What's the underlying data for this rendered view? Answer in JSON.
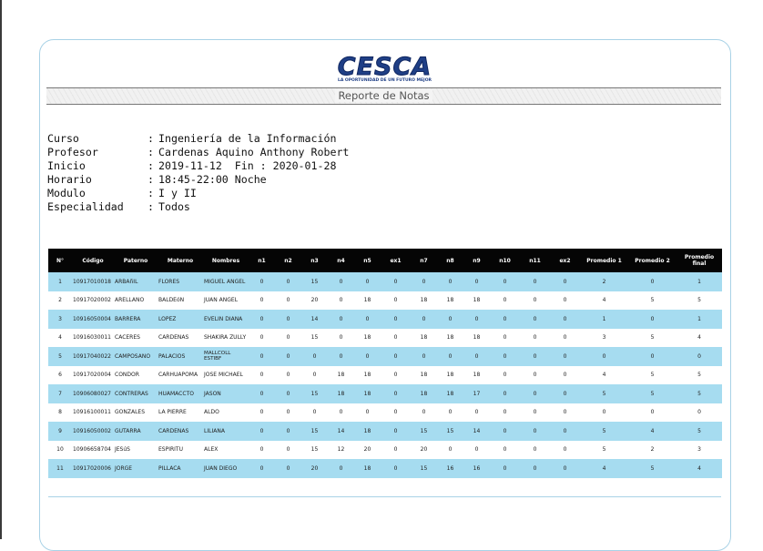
{
  "header": {
    "logo_text": "CESCA",
    "logo_tagline": "LA OPORTUNIDAD DE UN FUTURO MEJOR",
    "report_title": "Reporte de Notas"
  },
  "info": {
    "curso_label": "Curso",
    "curso_value": "Ingeniería de la Información",
    "profesor_label": "Profesor",
    "profesor_value": "Cardenas Aquino Anthony Robert",
    "inicio_label": "Inicio",
    "inicio_value": "2019-11-12  Fin : 2020-01-28",
    "horario_label": "Horario",
    "horario_value": "18:45-22:00 Noche",
    "modulo_label": "Modulo",
    "modulo_value": "I y II",
    "especialidad_label": "Especialidad",
    "especialidad_value": "Todos",
    "separator": ":"
  },
  "table": {
    "headers": [
      "N°",
      "Código",
      "Paterno",
      "Materno",
      "Nombres",
      "n1",
      "n2",
      "n3",
      "n4",
      "n5",
      "ex1",
      "n7",
      "n8",
      "n9",
      "n10",
      "n11",
      "ex2",
      "Promedio 1",
      "Promedio 2",
      "Promedio final"
    ],
    "rows": [
      [
        "1",
        "10917010018",
        "ARBAñIL",
        "FLORES",
        "MIGUEL ANGEL",
        "0",
        "0",
        "15",
        "0",
        "0",
        "0",
        "0",
        "0",
        "0",
        "0",
        "0",
        "0",
        "2",
        "0",
        "1"
      ],
      [
        "2",
        "10917020002",
        "ARELLANO",
        "BALDEóN",
        "JUAN ANGEL",
        "0",
        "0",
        "20",
        "0",
        "18",
        "0",
        "18",
        "18",
        "18",
        "0",
        "0",
        "0",
        "4",
        "5",
        "5"
      ],
      [
        "3",
        "10916050004",
        "BARRERA",
        "LOPEZ",
        "EVELIN DIANA",
        "0",
        "0",
        "14",
        "0",
        "0",
        "0",
        "0",
        "0",
        "0",
        "0",
        "0",
        "0",
        "1",
        "0",
        "1"
      ],
      [
        "4",
        "10916030011",
        "CACERES",
        "CARDENAS",
        "SHAKIRA ZULLY",
        "0",
        "0",
        "15",
        "0",
        "18",
        "0",
        "18",
        "18",
        "18",
        "0",
        "0",
        "0",
        "3",
        "5",
        "4"
      ],
      [
        "5",
        "10917040022",
        "CAMPOSANO",
        "PALACIOS",
        "MALLCOLL ESTIBF",
        "0",
        "0",
        "0",
        "0",
        "0",
        "0",
        "0",
        "0",
        "0",
        "0",
        "0",
        "0",
        "0",
        "0",
        "0"
      ],
      [
        "6",
        "10917020004",
        "CONDOR",
        "CARHUAPOMA",
        "JOSE MICHAEL",
        "0",
        "0",
        "0",
        "18",
        "18",
        "0",
        "18",
        "18",
        "18",
        "0",
        "0",
        "0",
        "4",
        "5",
        "5"
      ],
      [
        "7",
        "10906080027",
        "CONTRERAS",
        "HUAMACCTO",
        "JASON",
        "0",
        "0",
        "15",
        "18",
        "18",
        "0",
        "18",
        "18",
        "17",
        "0",
        "0",
        "0",
        "5",
        "5",
        "5"
      ],
      [
        "8",
        "10916100011",
        "GONZALES",
        "LA PIERRE",
        "ALDO",
        "0",
        "0",
        "0",
        "0",
        "0",
        "0",
        "0",
        "0",
        "0",
        "0",
        "0",
        "0",
        "0",
        "0",
        "0"
      ],
      [
        "9",
        "10916050002",
        "GUTARRA",
        "CARDENAS",
        "LILIANA",
        "0",
        "0",
        "15",
        "14",
        "18",
        "0",
        "15",
        "15",
        "14",
        "0",
        "0",
        "0",
        "5",
        "4",
        "5"
      ],
      [
        "10",
        "10906658704",
        "JESúS",
        "ESPIRITU",
        "ALEX",
        "0",
        "0",
        "15",
        "12",
        "20",
        "0",
        "20",
        "0",
        "0",
        "0",
        "0",
        "0",
        "5",
        "2",
        "3"
      ],
      [
        "11",
        "10917020006",
        "JORGE",
        "PILLACA",
        "JUAN DIEGO",
        "0",
        "0",
        "20",
        "0",
        "18",
        "0",
        "15",
        "16",
        "16",
        "0",
        "0",
        "0",
        "4",
        "5",
        "4"
      ]
    ]
  },
  "colors": {
    "row_highlight": "#a6dcf0",
    "header_bg": "#050505",
    "logo_blue": "#1f3f86",
    "card_border": "#a9d2e6"
  }
}
